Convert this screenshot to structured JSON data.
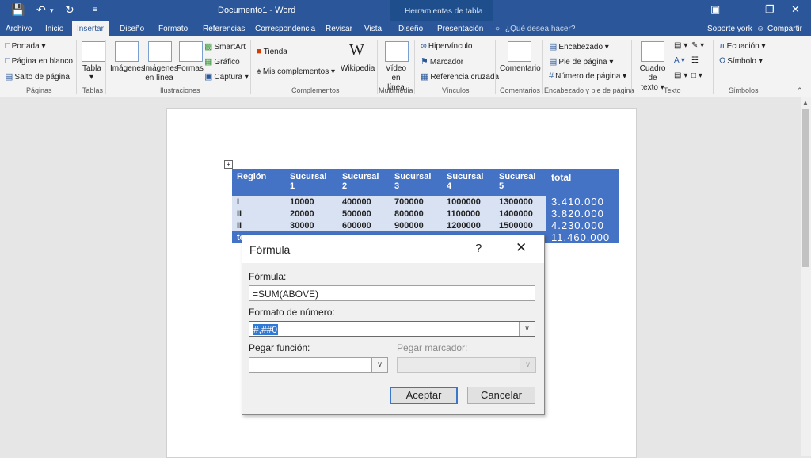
{
  "window": {
    "title": "Documento1 - Word",
    "context_title": "Herramientas de tabla"
  },
  "tabs": [
    {
      "label": "Archivo"
    },
    {
      "label": "Inicio"
    },
    {
      "label": "Insertar"
    },
    {
      "label": "Diseño"
    },
    {
      "label": "Formato"
    },
    {
      "label": "Referencias"
    },
    {
      "label": "Correspondencia"
    },
    {
      "label": "Revisar"
    },
    {
      "label": "Vista"
    },
    {
      "label": "Diseño"
    },
    {
      "label": "Presentación"
    }
  ],
  "tell_me": "¿Qué desea hacer?",
  "user": "Soporte york",
  "share": "Compartir",
  "ribbon": {
    "paginas": {
      "label": "Páginas",
      "items": [
        "Portada",
        "Página en blanco",
        "Salto de página"
      ]
    },
    "tablas": {
      "label": "Tablas",
      "tabla": "Tabla"
    },
    "ilustraciones": {
      "label": "Ilustraciones",
      "imagenes": "Imágenes",
      "imagenes_linea_1": "Imágenes",
      "imagenes_linea_2": "en línea",
      "formas": "Formas",
      "smartart": "SmartArt",
      "grafico": "Gráfico",
      "captura": "Captura"
    },
    "complementos": {
      "label": "Complementos",
      "tienda": "Tienda",
      "mis": "Mis complementos",
      "wikipedia": "Wikipedia"
    },
    "multimedia": {
      "label": "Multimedia",
      "video_1": "Vídeo",
      "video_2": "en línea"
    },
    "vinculos": {
      "label": "Vínculos",
      "items": [
        "Hipervínculo",
        "Marcador",
        "Referencia cruzada"
      ]
    },
    "comentarios": {
      "label": "Comentarios",
      "comentario": "Comentario"
    },
    "encabezado": {
      "label": "Encabezado y pie de página",
      "items": [
        "Encabezado",
        "Pie de página",
        "Número de página"
      ]
    },
    "texto": {
      "label": "Texto",
      "cuadro_1": "Cuadro de",
      "cuadro_2": "texto"
    },
    "simbolos": {
      "label": "Símbolos",
      "ecuacion": "Ecuación",
      "simbolo": "Símbolo"
    }
  },
  "table": {
    "headers": [
      "Región",
      "Sucursal 1",
      "Sucursal 2",
      "Sucursal 3",
      "Sucursal 4",
      "Sucursal 5",
      "total"
    ],
    "rows": [
      [
        "I",
        "10000",
        "400000",
        "700000",
        "1000000",
        "1300000",
        "3.410.000"
      ],
      [
        "II",
        "20000",
        "500000",
        "800000",
        "1100000",
        "1400000",
        "3.820.000"
      ],
      [
        "II",
        "30000",
        "600000",
        "900000",
        "1200000",
        "1500000",
        "4.230.000"
      ],
      [
        "to",
        "",
        "",
        "",
        "",
        "",
        "11.460.000"
      ]
    ]
  },
  "dialog": {
    "title": "Fórmula",
    "help": "?",
    "formula_label": "Fórmula:",
    "formula_value": "=SUM(ABOVE)",
    "format_label": "Formato de número:",
    "format_value": "#,##0",
    "paste_function_label": "Pegar función:",
    "paste_bookmark_label": "Pegar marcador:",
    "ok": "Aceptar",
    "cancel": "Cancelar"
  }
}
